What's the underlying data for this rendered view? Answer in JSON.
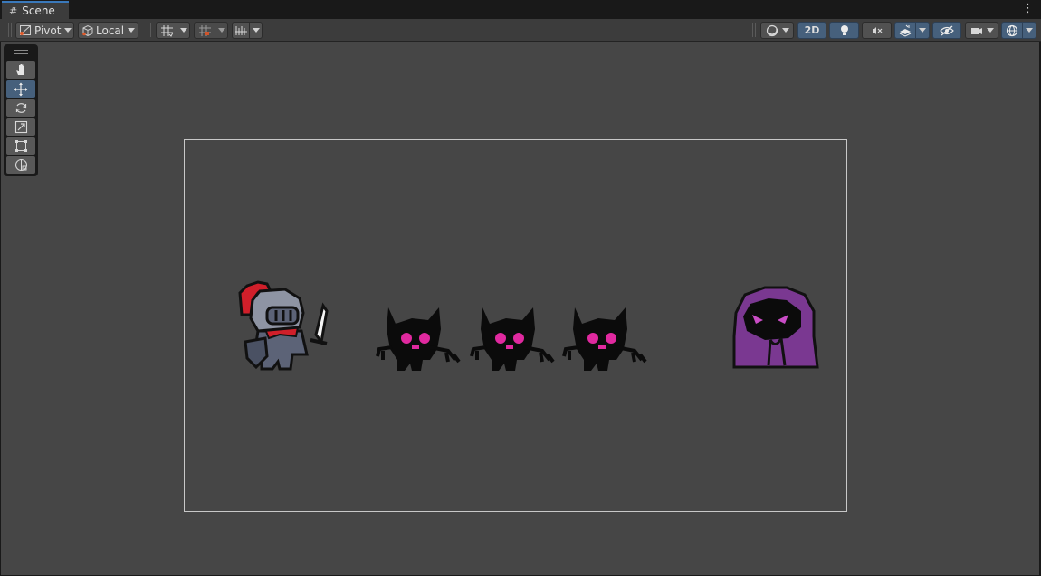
{
  "window": {
    "tab_title": "Scene",
    "tab_icon": "scene-grid-icon",
    "menu_icon": "kebab-menu-icon"
  },
  "toolbar": {
    "pivot_label": "Pivot",
    "local_label": "Local",
    "mode_2d_label": "2D",
    "left_tools": [
      "pivot-mode-dropdown",
      "space-mode-dropdown",
      "grid-visibility-toggle",
      "grid-snapping-toggle",
      "increment-snap-toggle"
    ],
    "right_tools": [
      "draw-mode-dropdown",
      "2d-toggle",
      "lighting-toggle",
      "audio-toggle",
      "effects-toggle",
      "scene-visibility-toggle",
      "camera-settings-dropdown",
      "gizmos-toggle"
    ]
  },
  "palette": {
    "tools": [
      {
        "name": "hand-tool",
        "icon": "hand-icon",
        "active": false
      },
      {
        "name": "move-tool",
        "icon": "move-arrows-icon",
        "active": true
      },
      {
        "name": "rotate-tool",
        "icon": "rotate-icon",
        "active": false
      },
      {
        "name": "scale-tool",
        "icon": "scale-icon",
        "active": false
      },
      {
        "name": "rect-tool",
        "icon": "rect-transform-icon",
        "active": false
      },
      {
        "name": "transform-tool",
        "icon": "transform-icon",
        "active": false
      }
    ]
  },
  "scene": {
    "sprites": [
      "knight",
      "imp",
      "imp",
      "imp",
      "hooded-cultist"
    ]
  },
  "colors": {
    "accent": "#3a79bb",
    "active_button": "#46607c",
    "viewport_bg": "#464646",
    "knight_plume": "#d01f2a",
    "imp_eyes": "#e0299f",
    "cultist_robe": "#7a3891"
  }
}
